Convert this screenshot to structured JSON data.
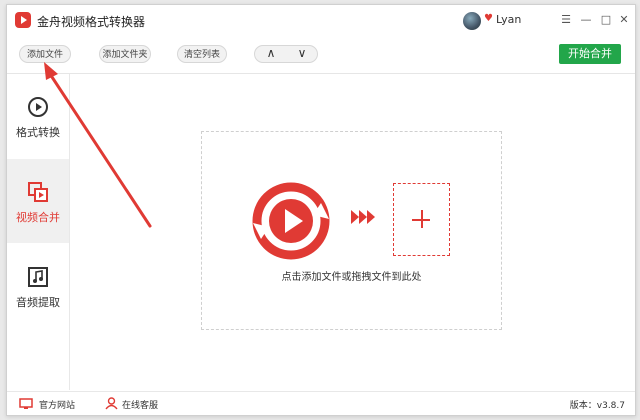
{
  "app": {
    "title": "金舟视频格式转换器"
  },
  "user": {
    "name": "Lyan"
  },
  "window_controls": {
    "menu": "☰",
    "minimize": "—",
    "maximize": "□",
    "close": "✕"
  },
  "toolbar": {
    "add_file": "添加文件",
    "add_folder": "添加文件夹",
    "clear_list": "清空列表",
    "move_up": "∧",
    "move_down": "∨",
    "start": "开始合并"
  },
  "sidebar": {
    "items": [
      {
        "label": "格式转换",
        "icon": "play-circle-icon",
        "active": false
      },
      {
        "label": "视频合并",
        "icon": "merge-icon",
        "active": true
      },
      {
        "label": "音频提取",
        "icon": "music-note-icon",
        "active": false
      }
    ]
  },
  "main": {
    "drop_hint": "点击添加文件或拖拽文件到此处"
  },
  "footer": {
    "website": "官方网站",
    "support": "在线客服",
    "version": "版本：v3.8.7"
  },
  "colors": {
    "accent": "#e03a34",
    "start_button": "#22a64a",
    "annotation_arrow": "#e03a34"
  }
}
